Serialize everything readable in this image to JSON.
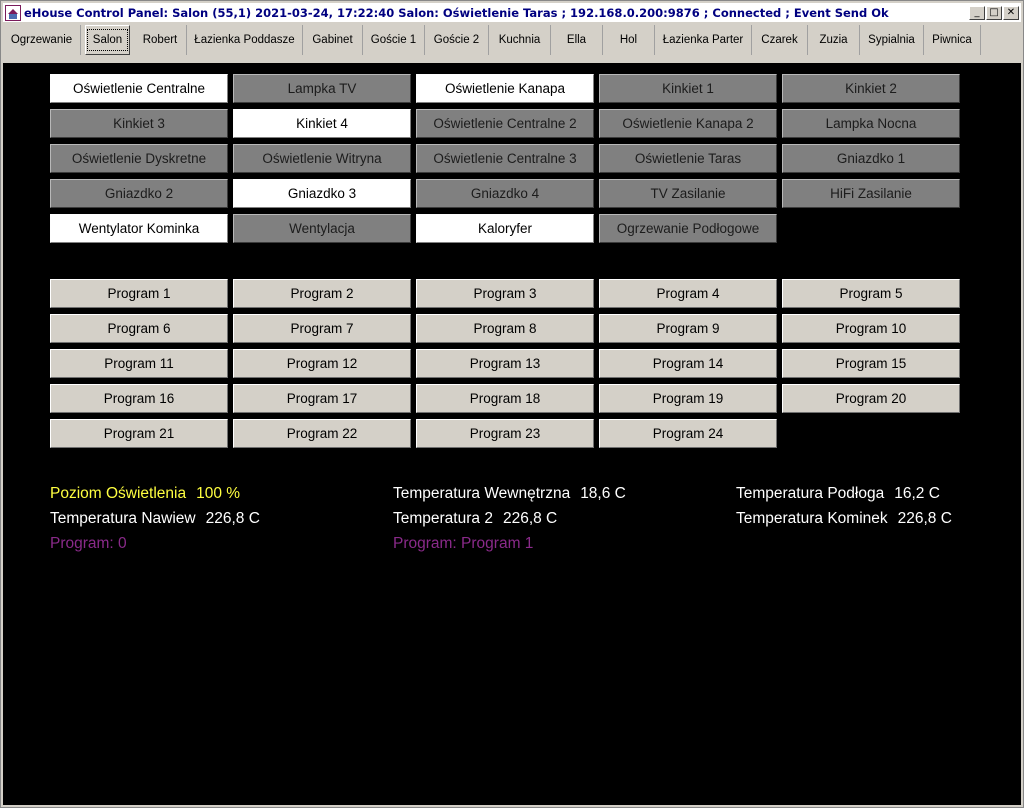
{
  "window": {
    "title": "eHouse Control Panel: Salon  (55,1) 2021-03-24, 17:22:40   Salon: Oświetlenie Taras ; 192.168.0.200:9876 ; Connected ; Event Send Ok",
    "minimize": "_",
    "maximize": "□",
    "close": "✕"
  },
  "tabs": [
    {
      "label": "Ogrzewanie",
      "active": false
    },
    {
      "label": "Salon",
      "active": true
    },
    {
      "label": "Robert",
      "active": false
    },
    {
      "label": "Łazienka Poddasze",
      "active": false
    },
    {
      "label": "Gabinet",
      "active": false
    },
    {
      "label": "Goście 1",
      "active": false
    },
    {
      "label": "Goście 2",
      "active": false
    },
    {
      "label": "Kuchnia",
      "active": false
    },
    {
      "label": "Ella",
      "active": false
    },
    {
      "label": "Hol",
      "active": false
    },
    {
      "label": "Łazienka Parter",
      "active": false
    },
    {
      "label": "Czarek",
      "active": false
    },
    {
      "label": "Zuzia",
      "active": false
    },
    {
      "label": "Sypialnia",
      "active": false
    },
    {
      "label": "Piwnica",
      "active": false
    }
  ],
  "outputs": [
    {
      "label": "Oświetlenie Centralne",
      "state": "on"
    },
    {
      "label": "Lampka TV",
      "state": "off"
    },
    {
      "label": "Oświetlenie Kanapa",
      "state": "on"
    },
    {
      "label": "Kinkiet 1",
      "state": "off"
    },
    {
      "label": "Kinkiet 2",
      "state": "off"
    },
    {
      "label": "Kinkiet 3",
      "state": "off"
    },
    {
      "label": "Kinkiet 4",
      "state": "on"
    },
    {
      "label": "Oświetlenie Centralne 2",
      "state": "off"
    },
    {
      "label": "Oświetlenie Kanapa 2",
      "state": "off"
    },
    {
      "label": "Lampka Nocna",
      "state": "off"
    },
    {
      "label": "Oświetlenie Dyskretne",
      "state": "off"
    },
    {
      "label": "Oświetlenie Witryna",
      "state": "off"
    },
    {
      "label": "Oświetlenie Centralne 3",
      "state": "off"
    },
    {
      "label": "Oświetlenie Taras",
      "state": "off"
    },
    {
      "label": "Gniazdko 1",
      "state": "off"
    },
    {
      "label": "Gniazdko 2",
      "state": "off"
    },
    {
      "label": "Gniazdko 3",
      "state": "on"
    },
    {
      "label": "Gniazdko 4",
      "state": "off"
    },
    {
      "label": "TV Zasilanie",
      "state": "off"
    },
    {
      "label": "HiFi Zasilanie",
      "state": "off"
    },
    {
      "label": "Wentylator Kominka",
      "state": "on"
    },
    {
      "label": "Wentylacja",
      "state": "off"
    },
    {
      "label": "Kaloryfer",
      "state": "on"
    },
    {
      "label": "Ogrzewanie Podłogowe",
      "state": "off"
    }
  ],
  "programs": [
    "Program 1",
    "Program 2",
    "Program 3",
    "Program 4",
    "Program 5",
    "Program 6",
    "Program 7",
    "Program 8",
    "Program 9",
    "Program 10",
    "Program 11",
    "Program 12",
    "Program 13",
    "Program 14",
    "Program 15",
    "Program 16",
    "Program 17",
    "Program 18",
    "Program 19",
    "Program 20",
    "Program 21",
    "Program 22",
    "Program 23",
    "Program 24"
  ],
  "status": {
    "light_level_label": "Poziom Oświetlenia",
    "light_level_value": "100 %",
    "temp_inside_label": "Temperatura Wewnętrzna",
    "temp_inside_value": "18,6 C",
    "temp_floor_label": "Temperatura Podłoga",
    "temp_floor_value": "16,2 C",
    "temp_vent_label": "Temperatura Nawiew",
    "temp_vent_value": "226,8 C",
    "temp2_label": "Temperatura 2",
    "temp2_value": "226,8 C",
    "temp_fireplace_label": "Temperatura Kominek",
    "temp_fireplace_value": "226,8 C",
    "program_left": "Program: 0",
    "program_right": "Program: Program 1"
  },
  "colors": {
    "panel_bg": "#000000",
    "button_on": "#ffffff",
    "button_off": "#808080",
    "program_button": "#d4d0c8",
    "light_level_text": "#ffff40",
    "program_text": "#8a2a8a",
    "title_text": "#000080"
  }
}
